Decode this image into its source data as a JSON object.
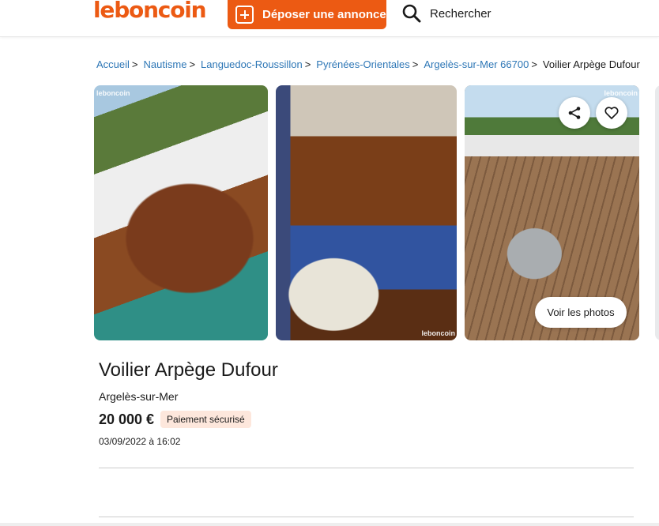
{
  "header": {
    "logo": "leboncoin",
    "post_label": "Déposer une annonce",
    "search_label": "Rechercher"
  },
  "breadcrumb": {
    "items": [
      "Accueil",
      "Nautisme",
      "Languedoc-Roussillon",
      "Pyrénées-Orientales",
      "Argelès-sur-Mer 66700"
    ],
    "current": "Voilier Arpège Dufour",
    "separator": ">"
  },
  "gallery": {
    "watermark": "leboncoin",
    "view_photos_label": "Voir les photos",
    "icons": [
      "share-icon",
      "heart-icon"
    ]
  },
  "ad": {
    "title": "Voilier Arpège Dufour",
    "location": "Argelès-sur-Mer",
    "price": "20 000 €",
    "badge": "Paiement sécurisé",
    "date": "03/09/2022 à 16:02"
  },
  "colors": {
    "brand": "#ec5a13",
    "link": "#2e77b6",
    "badge_bg": "#fde7dc"
  }
}
